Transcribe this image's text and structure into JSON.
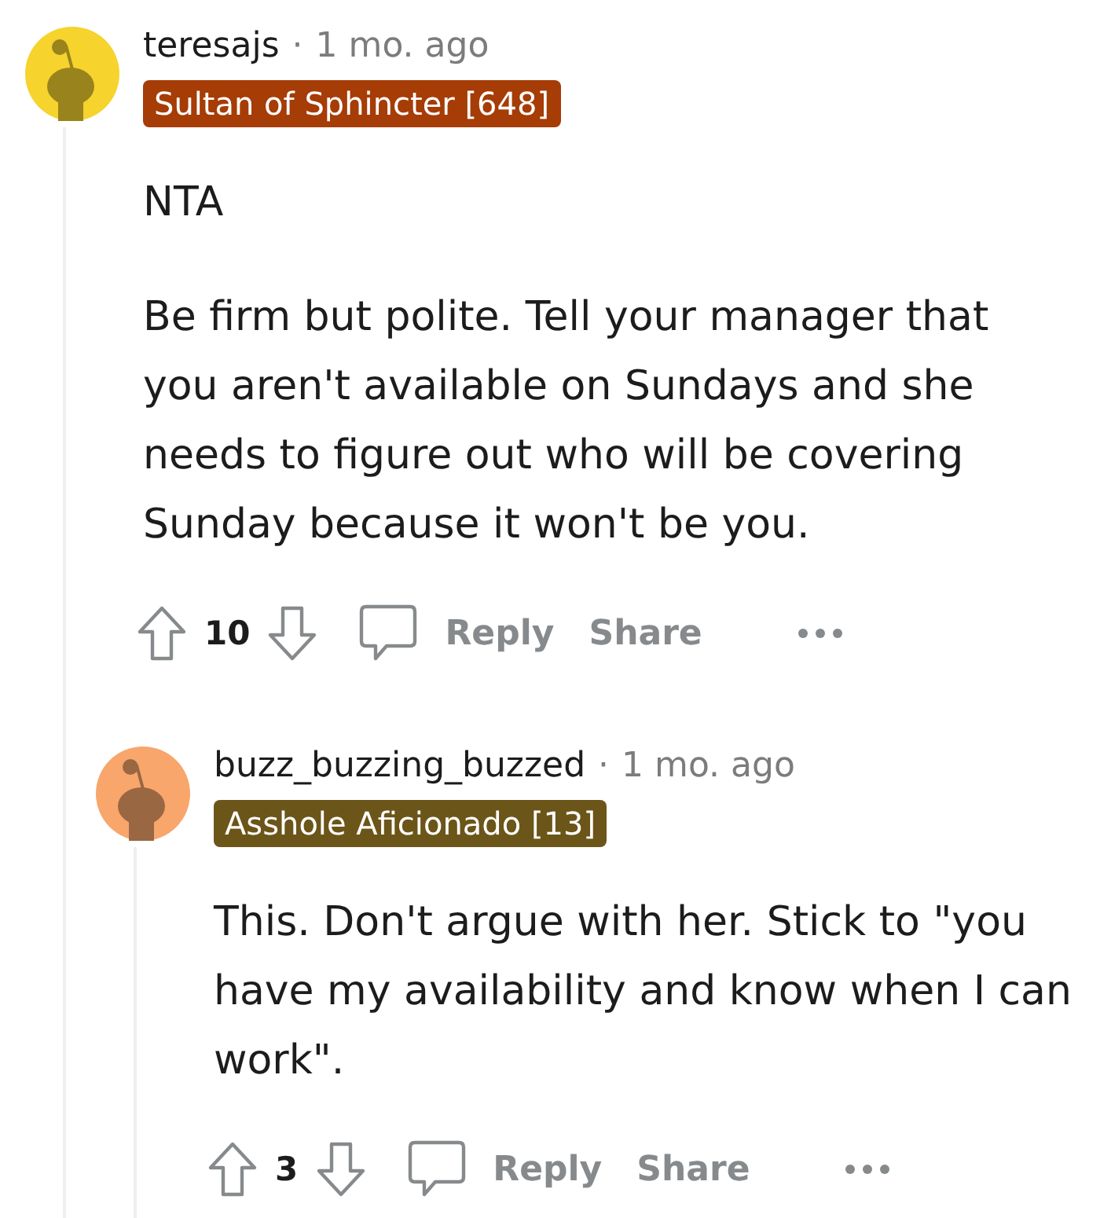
{
  "comments": [
    {
      "author": "teresajs",
      "separator": "·",
      "time": "1 mo. ago",
      "color": "#f6d32d",
      "flair": {
        "text": "Sultan of Sphincter [648]",
        "color": "#a63c06"
      },
      "paragraphs": [
        "NTA",
        "Be firm but polite. Tell your manager that you aren't available on Sundays and she needs to figure out who will be covering Sunday because it won't be you."
      ],
      "score": "10",
      "actions": [
        "Reply",
        "Share"
      ],
      "children": [
        {
          "author": "buzz_buzzing_buzzed",
          "separator": "·",
          "time": "1 mo. ago",
          "color": "#f8a66c",
          "flair": {
            "text": "Asshole Aficionado [13]",
            "color": "#6b5518"
          },
          "paragraphs": [
            "This. Don't argue with her. Stick to \"you have my availability and know when I can work\"."
          ],
          "score": "3",
          "actions": [
            "Reply",
            "Share"
          ]
        }
      ]
    }
  ]
}
